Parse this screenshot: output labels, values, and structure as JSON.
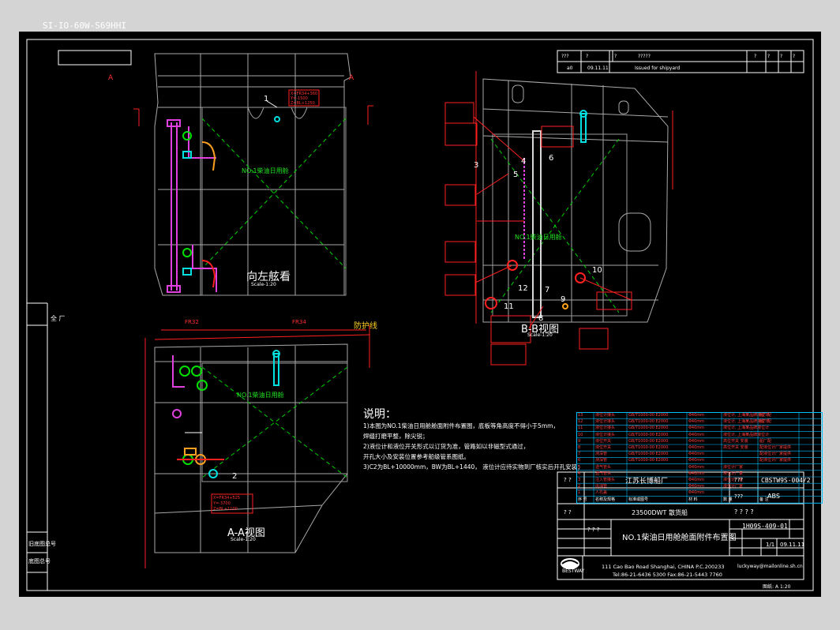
{
  "drawing": {
    "number_rotated": "SI-IO-60W-S69HHI",
    "views": {
      "left": {
        "title": "向左舷看",
        "scale": "Scale-1:20"
      },
      "aa": {
        "title": "A-A视图",
        "scale": "Scale-1:20"
      },
      "bb": {
        "title": "B-B视图",
        "scale": "Scale-1:20"
      }
    },
    "section_marker": "A",
    "tank_label": "NO.1柴油日用舱",
    "frame_labels": [
      "FR32",
      "FR34"
    ],
    "deck_label": "防护线",
    "callouts": [
      "1",
      "2",
      "3",
      "4",
      "5",
      "6",
      "7",
      "8",
      "9",
      "10",
      "11",
      "12"
    ],
    "coord_note_1": "X=FR34+360 Y=-1500 Z=BL+1250",
    "coord_note_2": "X=FR34+525 Y=-3700 Z=BL+1100"
  },
  "notes": {
    "heading": "说明：",
    "lines": [
      "1)本图为NO.1柴油日用舱舱面附件布置图，底板等角高度不得小于5mm，",
      "   焊缝打磨平整，除尖锐；",
      "2)液位计和液位开关形式以订货为准，管路如以非磁型式通过，",
      "   开孔大小及安装位置参考船级管系图纸。",
      "3)C2为BL+10000mm，BW为BL+1440，  液位计应待实物到厂核实后开孔安装；"
    ]
  },
  "revision": {
    "row1": [
      "???",
      "?",
      "?",
      "?????",
      "?",
      "?",
      "?",
      "?"
    ],
    "row2": [
      "a0",
      "09.11.11",
      "Issued for shipyard"
    ]
  },
  "left_sidebar": {
    "top_label": "全 厂",
    "bottom_labels": [
      "旧底图总号",
      "底图总号"
    ]
  },
  "parts_table": {
    "header": [
      "序 号",
      "名称及规格",
      "标准或图号",
      "材 料",
      "数 量",
      "备 注"
    ],
    "rows": [
      {
        "no": "13",
        "name": "液位计接头",
        "std": "GB/T1000-00 E2000",
        "mat": "Φ40mm",
        "qty": "1",
        "note": "液位计, 上海某品牌液位计",
        "remark": "船厂配"
      },
      {
        "no": "12",
        "name": "液位计接头",
        "std": "GB/T1000-00 E2000",
        "mat": "Φ40mm",
        "qty": "1",
        "note": "液位计, 上海某品牌液位计",
        "remark": "船厂配"
      },
      {
        "no": "11",
        "name": "液位计接头",
        "std": "GB/T1000-00 E2000",
        "mat": "Φ40mm",
        "qty": "1",
        "note": "液位计, 上海某品牌液位计",
        "remark": ""
      },
      {
        "no": "10",
        "name": "液位计接头",
        "std": "GB/T1000-00 E2000",
        "mat": "Φ40mm",
        "qty": "1",
        "note": "液位计, 上海某品牌液位计",
        "remark": ""
      },
      {
        "no": "9",
        "name": "液位开关",
        "std": "GB/T1000-00 E2000",
        "mat": "Φ40mm",
        "qty": "1",
        "note": "高位开关 安装",
        "remark": "船厂配"
      },
      {
        "no": "8",
        "name": "液位开关",
        "std": "GB/T1000-00 E2000",
        "mat": "Φ40mm",
        "qty": "1",
        "note": "高位开关 安装",
        "remark": "配液位计厂家提供"
      },
      {
        "no": "7",
        "name": "测深管",
        "std": "GB/T1000-00 E2000",
        "mat": "Φ40mm",
        "qty": "1",
        "note": "",
        "remark": "配液位计厂家提供"
      },
      {
        "no": "6",
        "name": "测深管",
        "std": "GB/T1000-00 E2000",
        "mat": "Φ40mm",
        "qty": "1",
        "note": "",
        "remark": "配液位计厂家提供"
      },
      {
        "no": "5",
        "name": "透气管头",
        "std": "",
        "mat": "Φ40mm",
        "qty": "1",
        "note": "液位计厂家",
        "remark": ""
      },
      {
        "no": "4",
        "name": "透气管头",
        "std": "",
        "mat": "Φ40mm",
        "qty": "1",
        "note": "液位计厂家",
        "remark": ""
      },
      {
        "no": "3",
        "name": "注入管接头",
        "std": "",
        "mat": "Φ40mm",
        "qty": "1",
        "note": "液位计厂家",
        "remark": ""
      },
      {
        "no": "2",
        "name": "出油管",
        "std": "",
        "mat": "Φ40mm",
        "qty": "1",
        "note": "液位计厂家",
        "remark": ""
      },
      {
        "no": "1",
        "name": "人孔盖",
        "std": "",
        "mat": "Φ40mm",
        "qty": "1",
        "note": "",
        "remark": ""
      }
    ]
  },
  "title_block": {
    "yard": "江苏长博船厂",
    "project_code": "CBSTW9S-004/2",
    "class": "ABS",
    "ship": "23500DWT 散货船",
    "unknown_marks": [
      "? ?",
      "???",
      "? ? ? ?",
      "? ? ?"
    ],
    "drawing_no": "1H09S-409-01",
    "drawing_title": "NO.1柴油日用舱舱面附件布置图",
    "sheet": "1/1",
    "date": "09.11.11",
    "sheet_scale_label": "???",
    "company": "BESTWAY",
    "address": "111 Cao Bao Road Shanghai, CHINA  P.C.200233",
    "phone": "Tel:86-21-6436 5300  Fax:86-21-5443 7760",
    "email": "luckyway@mailonline.sh.cn",
    "status_bar": "图纸: A 1:20"
  },
  "colors": {
    "background": "#000000",
    "frame": "#ffffff",
    "structure": "#b0b0b0",
    "tank_diagonal": "#00d000",
    "annotation": "#ff2020",
    "piping": "#e040e0",
    "equipment": "#00e0e0",
    "parts_table": "#00bfff"
  }
}
